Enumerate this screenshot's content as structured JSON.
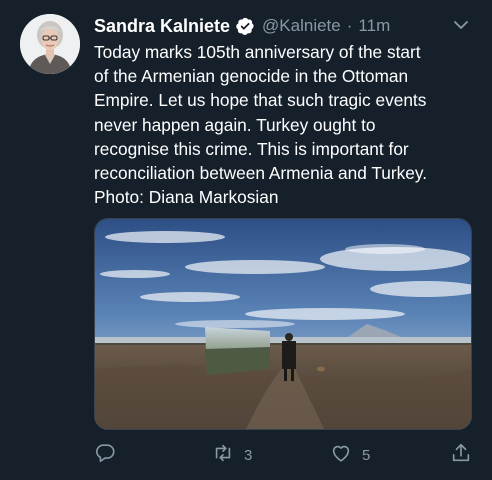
{
  "tweet": {
    "author_name": "Sandra Kalniete",
    "handle": "@Kalniete",
    "separator": "·",
    "time": "11m",
    "text_lines": [
      "Today marks 105th anniversary of the start",
      "of the Armenian genocide in the Ottoman",
      "Empire. Let us hope that such tragic events",
      "never happen again. Turkey ought to",
      "recognise this crime. This is important for",
      "reconciliation between Armenia and Turkey.",
      "Photo: Diana Markosian"
    ],
    "retweet_count": "3",
    "like_count": "5"
  },
  "icons": {
    "verified": "verified-badge-icon",
    "menu": "chevron-down-icon",
    "reply": "reply-icon",
    "retweet": "retweet-icon",
    "like": "heart-icon",
    "share": "share-icon"
  },
  "colors": {
    "background": "#15202b",
    "secondary_text": "#8899a6",
    "verified": "#1da1f2",
    "border": "#38444d"
  }
}
